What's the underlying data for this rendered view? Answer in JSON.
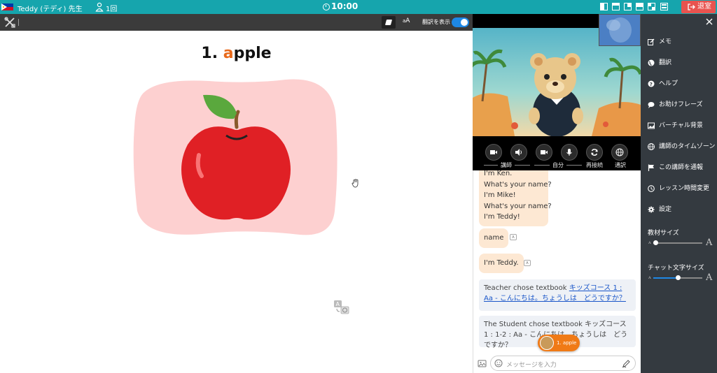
{
  "topbar": {
    "teacher_name": "Teddy (テディ) 先生",
    "count": "1回",
    "timer": "10:00",
    "exit_label": "退室"
  },
  "toolbar": {
    "aa_label_small": "a",
    "aa_label_large": "A",
    "translate_label": "翻訳を表示",
    "translate_on": true
  },
  "lesson": {
    "number": "1.",
    "word_first": "a",
    "word_rest": "pple"
  },
  "video": {
    "controls": {
      "teacher_label": "講師",
      "self_label": "自分",
      "reconnect_label": "再接続",
      "interpreter_label": "通訳"
    }
  },
  "chat": {
    "bubble1_lines": [
      "I'm Ken.",
      "What's your name?",
      "I'm Mike!",
      "What's your name?",
      "I'm Teddy!"
    ],
    "bubble2": "name",
    "bubble3": "I'm Teddy.",
    "sys1_prefix": "Teacher chose textbook ",
    "sys1_link": "キッズコース 1 : Aa - こんにちは。ちょうしは　どうですか？",
    "sys2": "The Student chose textbook キッズコース 1 : 1-2 : Aa - こんにちは。ちょうしは　どうですか？",
    "pill_label": "1. apple",
    "input_placeholder": "メッセージを入力"
  },
  "sidebar": {
    "items": [
      {
        "label": "メモ",
        "icon": "memo-icon"
      },
      {
        "label": "翻訳",
        "icon": "globe-icon"
      },
      {
        "label": "ヘルプ",
        "icon": "help-icon"
      },
      {
        "label": "お助けフレーズ",
        "icon": "chat-icon"
      },
      {
        "label": "バーチャル背景",
        "icon": "image-icon"
      },
      {
        "label": "講師のタイムゾーン",
        "icon": "world-icon"
      },
      {
        "label": "この講師を通報",
        "icon": "flag-icon"
      },
      {
        "label": "レッスン時間変更",
        "icon": "clock-icon"
      },
      {
        "label": "設定",
        "icon": "gear-icon"
      }
    ],
    "material_size_label": "教材サイズ",
    "material_size_value": 0.05,
    "chat_size_label": "チャット文字サイズ",
    "chat_size_value": 0.5,
    "slider_small": "A",
    "slider_large": "A"
  },
  "colors": {
    "topbar": "#16a5ad",
    "accent_orange": "#e86a1c",
    "bubble": "#fde8d3",
    "sidebar": "#343a40",
    "exit": "#e8534f",
    "toggle": "#1e88e5"
  }
}
